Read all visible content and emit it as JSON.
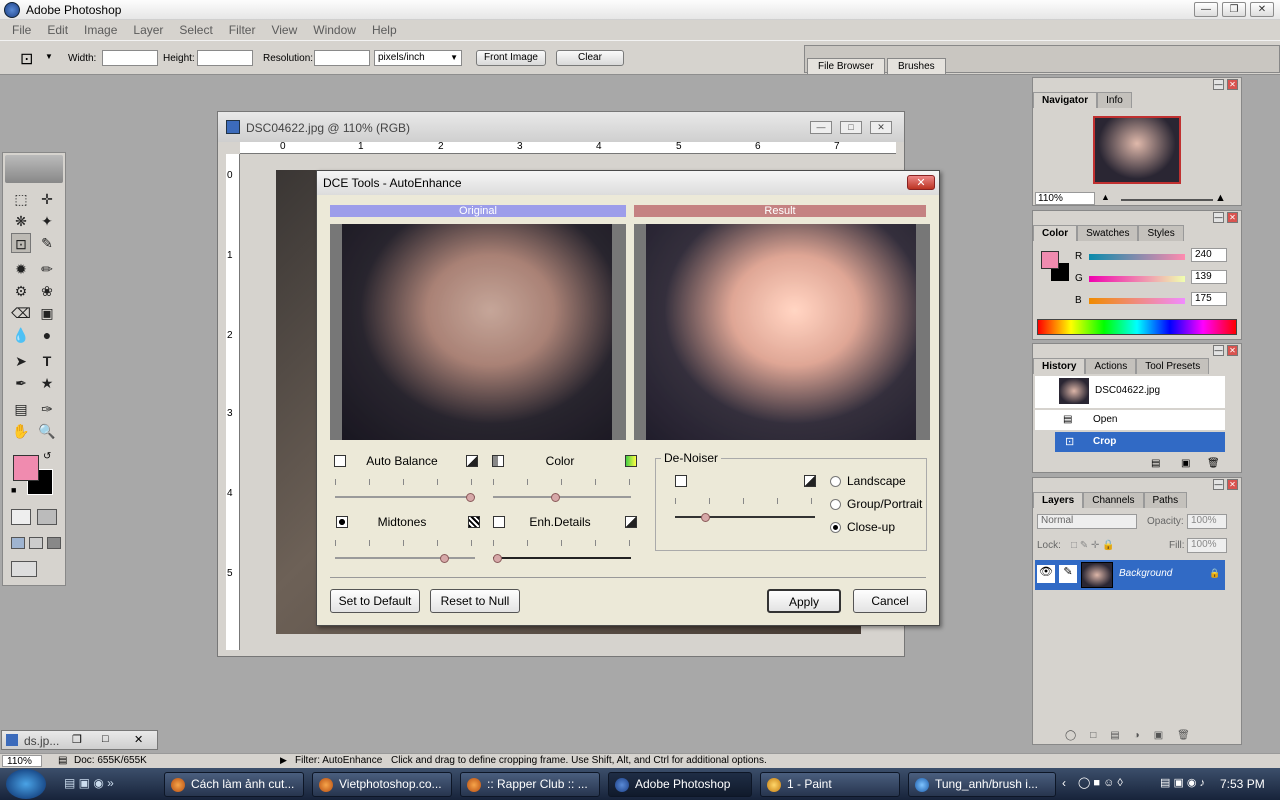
{
  "app": {
    "title": "Adobe Photoshop"
  },
  "menu": [
    "File",
    "Edit",
    "Image",
    "Layer",
    "Select",
    "Filter",
    "View",
    "Window",
    "Help"
  ],
  "options": {
    "width_label": "Width:",
    "height_label": "Height:",
    "resolution_label": "Resolution:",
    "units": "pixels/inch",
    "front_image": "Front Image",
    "clear": "Clear",
    "well_tabs": [
      "File Browser",
      "Brushes"
    ]
  },
  "document": {
    "title": "DSC04622.jpg @ 110% (RGB)",
    "ruler_h": [
      "0",
      "1",
      "2",
      "3",
      "4",
      "5",
      "6",
      "7"
    ],
    "ruler_v": [
      "0",
      "1",
      "2",
      "3",
      "4",
      "5"
    ]
  },
  "dialog": {
    "title": "DCE Tools - AutoEnhance",
    "original_label": "Original",
    "result_label": "Result",
    "sliders": {
      "auto_balance": {
        "label": "Auto Balance",
        "value": 1.0
      },
      "color": {
        "label": "Color",
        "value": 0.45
      },
      "midtones": {
        "label": "Midtones",
        "value": 0.8
      },
      "enh_details": {
        "label": "Enh.Details",
        "value": 0.0
      },
      "denoiser": {
        "label": "De-Noiser",
        "value": 0.2
      }
    },
    "denoise_options": [
      "Landscape",
      "Group/Portrait",
      "Close-up"
    ],
    "denoise_selected": "Close-up",
    "buttons": {
      "default": "Set to Default",
      "null": "Reset to Null",
      "apply": "Apply",
      "cancel": "Cancel"
    }
  },
  "navigator": {
    "tabs": [
      "Navigator",
      "Info"
    ],
    "zoom": "110%"
  },
  "color": {
    "tabs": [
      "Color",
      "Swatches",
      "Styles"
    ],
    "r_label": "R",
    "g_label": "G",
    "b_label": "B",
    "r": "240",
    "g": "139",
    "b": "175",
    "fg": "#f08baf"
  },
  "history": {
    "tabs": [
      "History",
      "Actions",
      "Tool Presets"
    ],
    "snapshot": "DSC04622.jpg",
    "items": [
      "Open",
      "Crop"
    ]
  },
  "layers": {
    "tabs": [
      "Layers",
      "Channels",
      "Paths"
    ],
    "blend": "Normal",
    "opacity_label": "Opacity:",
    "opacity": "100%",
    "lock_label": "Lock:",
    "fill_label": "Fill:",
    "fill": "100%",
    "layer": "Background"
  },
  "minimized_doc": {
    "title": "ds.jp..."
  },
  "status": {
    "zoom": "110%",
    "doc": "Doc: 655K/655K",
    "filter": "Filter: AutoEnhance",
    "hint": "Click and drag to define cropping frame. Use Shift, Alt, and Ctrl for additional options."
  },
  "taskbar": {
    "tasks": [
      "Cách làm ảnh cut...",
      "Vietphotoshop.co...",
      ":: Rapper Club :: ...",
      "Adobe Photoshop",
      "1 - Paint",
      "Tung_anh/brush i..."
    ],
    "clock": "7:53 PM"
  }
}
